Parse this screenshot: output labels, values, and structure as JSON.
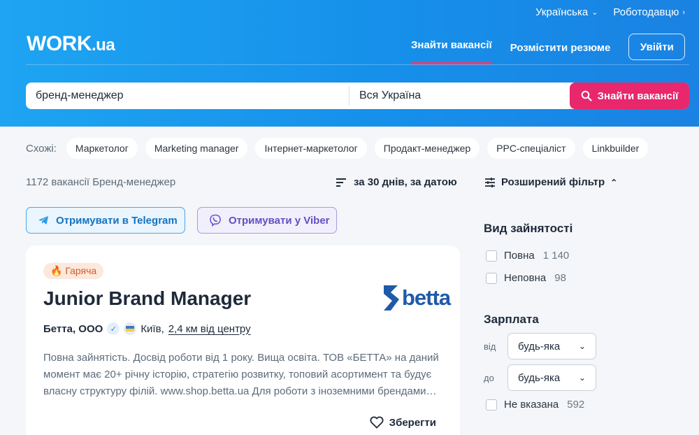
{
  "topbar": {
    "language": "Українська",
    "employer": "Роботодавцю"
  },
  "logo": {
    "main": "WORK",
    "suffix": ".ua"
  },
  "nav": {
    "find_jobs": "Знайти вакансії",
    "post_resume": "Розмістити резюме",
    "login": "Увійти"
  },
  "search": {
    "query": "бренд-менеджер",
    "location": "Вся Україна",
    "button": "Знайти вакансії"
  },
  "similar": {
    "label": "Схожі:",
    "chips": [
      "Маркетолог",
      "Marketing manager",
      "Інтернет-маркетолог",
      "Продакт-менеджер",
      "PPC-спеціаліст",
      "Linkbuilder"
    ]
  },
  "results": {
    "count_text": "1172 вакансії Бренд-менеджер",
    "sort": "за 30 днів, за датою"
  },
  "subscribe": {
    "telegram": "Отримувати в Telegram",
    "viber": "Отримувати у Viber"
  },
  "job": {
    "badge": "Гаряча",
    "title": "Junior Brand Manager",
    "company": "Бетта, ООО",
    "city": "Київ,",
    "distance": "2,4 км від центру",
    "description": "Повна зайнятість. Досвід роботи від 1 року. Вища освіта. ТОВ «БЕТТА» на даний момент має 20+ річну історію, стратегію розвитку, топовий асортимент та будує власну структуру філій. www.shop.betta.ua Для роботи з іноземними брендами…",
    "save": "Зберегти",
    "logo_text": "betta"
  },
  "filter": {
    "advanced": "Розширений фільтр",
    "employment": {
      "title": "Вид зайнятості",
      "options": [
        {
          "label": "Повна",
          "count": "1 140"
        },
        {
          "label": "Неповна",
          "count": "98"
        }
      ]
    },
    "salary": {
      "title": "Зарплата",
      "from_label": "від",
      "from_value": "будь-яка",
      "to_label": "до",
      "to_value": "будь-яка",
      "unspecified": {
        "label": "Не вказана",
        "count": "592"
      }
    }
  },
  "colors": {
    "header": "#1690ea",
    "accent": "#e8276d",
    "telegram": "#1573c0",
    "viber": "#6250c2",
    "betta": "#1f5aa8"
  }
}
